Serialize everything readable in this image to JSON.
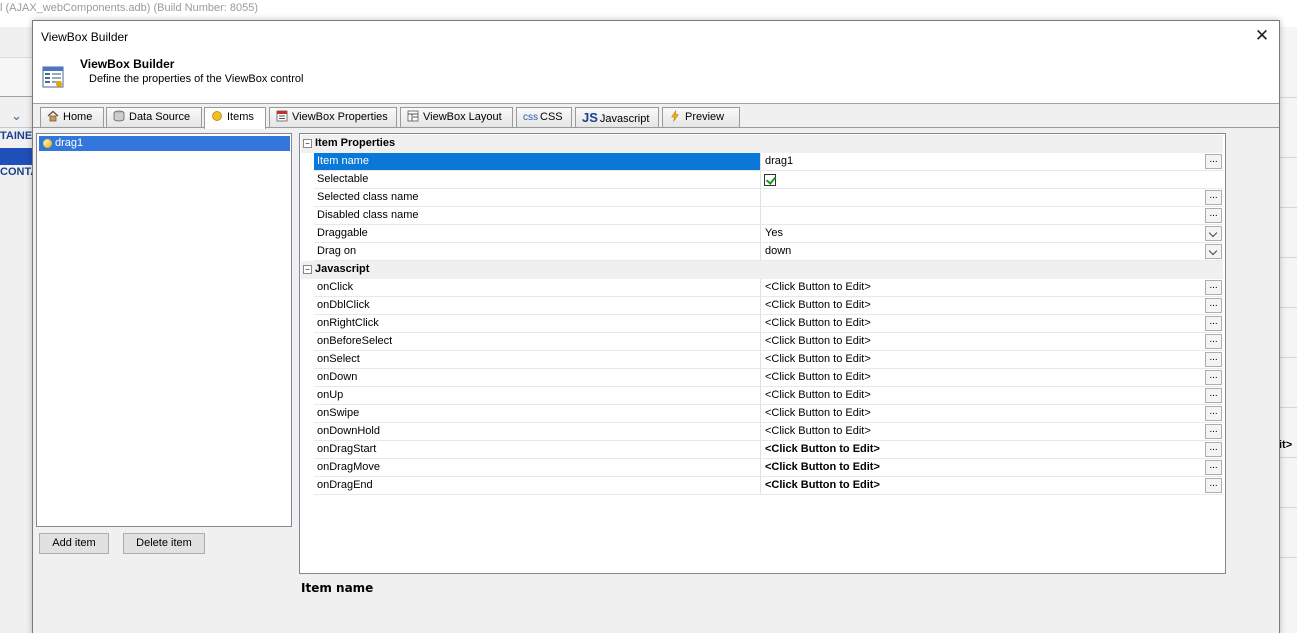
{
  "background_app": {
    "title": "l (AJAX_webComponents.adb) (Build Number: 8055)",
    "tree_label_1": "TAINEI",
    "tree_label_2": "CONTA",
    "right_fragment": "it>"
  },
  "dialog": {
    "title": "ViewBox Builder",
    "close_glyph": "✕",
    "header_title": "ViewBox Builder",
    "header_subtitle": "Define the properties of the ViewBox control"
  },
  "tabs": [
    {
      "label": "Home",
      "icon": "home-icon"
    },
    {
      "label": "Data Source",
      "icon": "database-icon"
    },
    {
      "label": "Items",
      "icon": "item-dot-icon",
      "active": true
    },
    {
      "label": "ViewBox Properties",
      "icon": "properties-icon"
    },
    {
      "label": "ViewBox Layout",
      "icon": "layout-icon"
    },
    {
      "label": "CSS",
      "icon": "css-icon",
      "icon_text": "css"
    },
    {
      "label": "Javascript",
      "icon": "js-icon",
      "icon_text": "JS"
    },
    {
      "label": "Preview",
      "icon": "lightning-icon"
    }
  ],
  "items_list": {
    "items": [
      "drag1"
    ],
    "add_label": "Add item",
    "delete_label": "Delete item"
  },
  "property_grid": {
    "categories": [
      {
        "label": "Item Properties",
        "toggle": "−"
      },
      {
        "label": "Javascript",
        "toggle": "−"
      }
    ],
    "item_properties": [
      {
        "name": "Item name",
        "value": "drag1",
        "editor": "ellipsis",
        "selected": true
      },
      {
        "name": "Selectable",
        "value": "",
        "editor": "checkbox",
        "checked": true
      },
      {
        "name": "Selected class name",
        "value": "",
        "editor": "ellipsis"
      },
      {
        "name": "Disabled class name",
        "value": "",
        "editor": "ellipsis"
      },
      {
        "name": "Draggable",
        "value": "Yes",
        "editor": "dropdown"
      },
      {
        "name": "Drag on",
        "value": "down",
        "editor": "dropdown"
      }
    ],
    "javascript": [
      {
        "name": "onClick",
        "value": "<Click Button to Edit>",
        "bold": false
      },
      {
        "name": "onDblClick",
        "value": "<Click Button to Edit>",
        "bold": false
      },
      {
        "name": "onRightClick",
        "value": "<Click Button to Edit>",
        "bold": false
      },
      {
        "name": "onBeforeSelect",
        "value": "<Click Button to Edit>",
        "bold": false
      },
      {
        "name": "onSelect",
        "value": "<Click Button to Edit>",
        "bold": false
      },
      {
        "name": "onDown",
        "value": "<Click Button to Edit>",
        "bold": false
      },
      {
        "name": "onUp",
        "value": "<Click Button to Edit>",
        "bold": false
      },
      {
        "name": "onSwipe",
        "value": "<Click Button to Edit>",
        "bold": false
      },
      {
        "name": "onDownHold",
        "value": "<Click Button to Edit>",
        "bold": false
      },
      {
        "name": "onDragStart",
        "value": "<Click Button to Edit>",
        "bold": true
      },
      {
        "name": "onDragMove",
        "value": "<Click Button to Edit>",
        "bold": true
      },
      {
        "name": "onDragEnd",
        "value": "<Click Button to Edit>",
        "bold": true
      }
    ],
    "ellipsis_label": "..."
  },
  "description": {
    "title": "Item name"
  },
  "colors": {
    "selection": "#0a78d7",
    "list_selection": "#3377dd",
    "check": "#1c9a1c"
  }
}
